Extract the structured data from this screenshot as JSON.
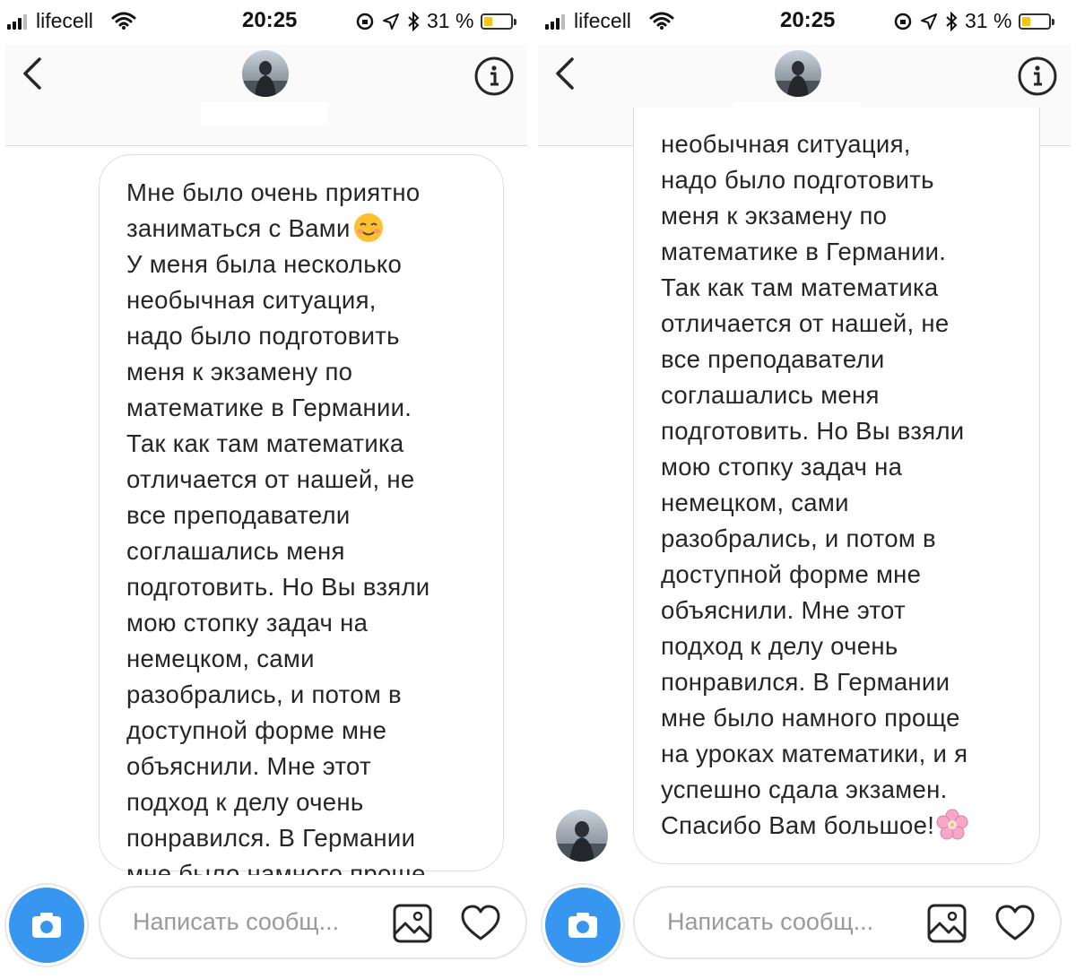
{
  "status_bar": {
    "carrier": "lifecell",
    "time": "20:25",
    "battery": "31 %",
    "battery_level": 0.31
  },
  "composer": {
    "placeholder": "Написать сообщ..."
  },
  "left_message": {
    "lines": [
      "Мне было очень приятно",
      "заниматься с Вами",
      "У меня была несколько",
      "необычная ситуация,",
      "надо было подготовить",
      "меня к экзамену по",
      "математике в Германии.",
      "Так как там математика",
      "отличается от нашей, не",
      "все преподаватели",
      "соглашались меня",
      "подготовить. Но Вы взяли",
      "мою стопку задач на",
      "немецком, сами",
      "разобрались, и потом в",
      "доступной форме мне",
      "объяснили. Мне этот",
      "подход к делу очень",
      "понравился. В Германии",
      "мне было намного проще"
    ],
    "emoji": "smiling-face-emoji"
  },
  "right_message": {
    "lines": [
      "необычная ситуация,",
      "надо было подготовить",
      "меня к экзамену по",
      "математике в Германии.",
      "Так как там математика",
      "отличается от нашей, не",
      "все преподаватели",
      "соглашались меня",
      "подготовить. Но Вы взяли",
      "мою стопку задач на",
      "немецком, сами",
      "разобрались, и потом в",
      "доступной форме мне",
      "объяснили. Мне этот",
      "подход к делу очень",
      "понравился. В Германии",
      "мне было намного проще",
      "на уроках математики, и я",
      "успешно сдала экзамен.",
      "Спасибо Вам большое!"
    ],
    "emoji": "cherry-blossom-emoji"
  }
}
